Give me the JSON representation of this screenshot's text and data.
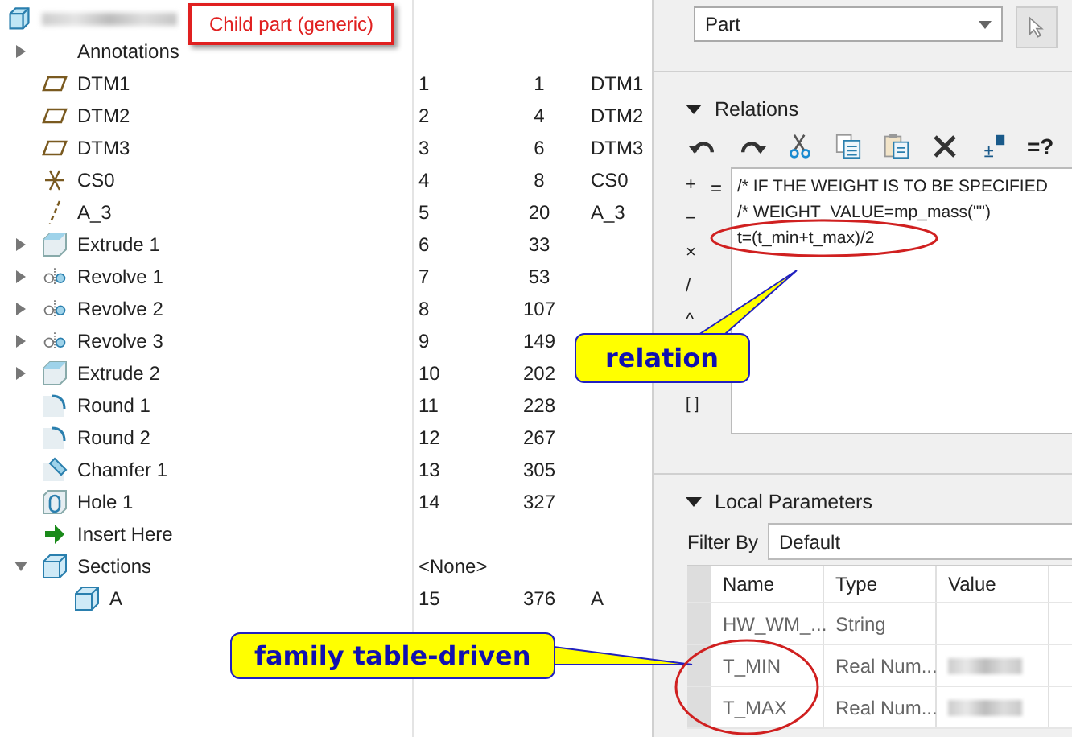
{
  "model_tree": {
    "items": [
      {
        "label": "Annotations",
        "kind": "none",
        "expanded": false
      },
      {
        "label": "DTM1",
        "kind": "plane",
        "col_1": "1",
        "col_2": "1",
        "col_3": "DTM1"
      },
      {
        "label": "DTM2",
        "kind": "plane",
        "col_1": "2",
        "col_2": "4",
        "col_3": "DTM2"
      },
      {
        "label": "DTM3",
        "kind": "plane",
        "col_1": "3",
        "col_2": "6",
        "col_3": "DTM3"
      },
      {
        "label": "CS0",
        "kind": "csys",
        "col_1": "4",
        "col_2": "8",
        "col_3": "CS0"
      },
      {
        "label": "A_3",
        "kind": "axis",
        "col_1": "5",
        "col_2": "20",
        "col_3": "A_3"
      },
      {
        "label": "Extrude 1",
        "kind": "extrude",
        "expanded": false,
        "col_1": "6",
        "col_2": "33"
      },
      {
        "label": "Revolve 1",
        "kind": "revolve",
        "expanded": false,
        "col_1": "7",
        "col_2": "53"
      },
      {
        "label": "Revolve 2",
        "kind": "revolve",
        "expanded": false,
        "col_1": "8",
        "col_2": "107"
      },
      {
        "label": "Revolve 3",
        "kind": "revolve",
        "expanded": false,
        "col_1": "9",
        "col_2": "149"
      },
      {
        "label": "Extrude 2",
        "kind": "extrude",
        "expanded": false,
        "col_1": "10",
        "col_2": "202"
      },
      {
        "label": "Round 1",
        "kind": "round",
        "col_1": "11",
        "col_2": "228"
      },
      {
        "label": "Round 2",
        "kind": "round",
        "col_1": "12",
        "col_2": "267"
      },
      {
        "label": "Chamfer 1",
        "kind": "chamfer",
        "col_1": "13",
        "col_2": "305"
      },
      {
        "label": "Hole 1",
        "kind": "hole",
        "col_1": "14",
        "col_2": "327"
      },
      {
        "label": "Insert Here",
        "kind": "insert"
      },
      {
        "label": "Sections",
        "kind": "section",
        "expanded": true,
        "col_1": "<None>",
        "children": [
          {
            "label": "A",
            "kind": "section",
            "col_1": "15",
            "col_2": "376",
            "col_3": "A"
          }
        ]
      }
    ]
  },
  "type_selector": {
    "value": "Part"
  },
  "relations": {
    "title": "Relations",
    "expanded": true,
    "toolbar_text": "=?",
    "operators": [
      "+",
      "−",
      "×",
      "/",
      "^",
      "[ ]"
    ],
    "equals": "=",
    "lines": [
      "/* IF THE WEIGHT IS TO BE SPECIFIED",
      "/* WEIGHT_VALUE=mp_mass(\"\")",
      "t=(t_min+t_max)/2"
    ]
  },
  "local_parameters": {
    "title": "Local Parameters",
    "expanded": true,
    "filter_label": "Filter By",
    "filter_value": "Default",
    "columns": [
      "Name",
      "Type",
      "Value"
    ],
    "rows": [
      {
        "name": "HW_WM_...",
        "type": "String",
        "value_hidden": false
      },
      {
        "name": "T_MIN",
        "type": "Real Num...",
        "value_hidden": true
      },
      {
        "name": "T_MAX",
        "type": "Real Num...",
        "value_hidden": true
      }
    ]
  },
  "annotations": [
    {
      "kind": "label",
      "text": "Child part (generic)"
    },
    {
      "kind": "callout",
      "text": "relation"
    },
    {
      "kind": "callout",
      "text": "family table-driven"
    }
  ]
}
